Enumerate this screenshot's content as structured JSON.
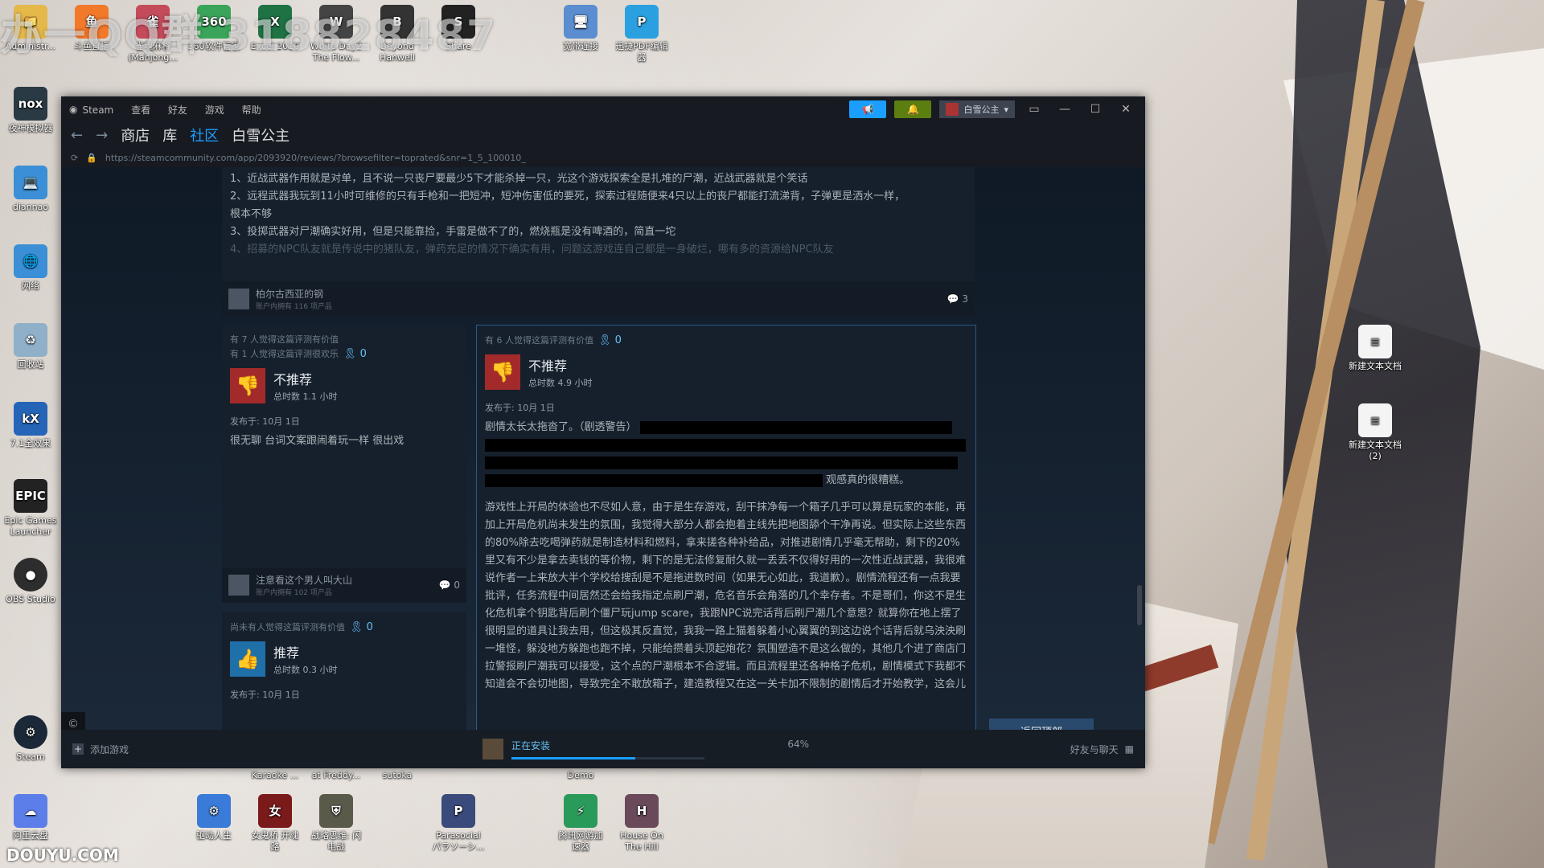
{
  "watermark": "办一QQ群 318828487",
  "brand": "DOUYU.COM",
  "desktop_icons": {
    "admin": "Administr...",
    "douyu_live": "斗鱼直播",
    "mahjong": "雀魂麻将\n(Mahjong...",
    "guanjia": "360软件管家",
    "excel": "Excel 2010",
    "whiteday": "White Day2\nThe Flow...",
    "beyond": "Beyond\nHanwell",
    "share": "Share",
    "broadband": "宽带连接",
    "pdf": "迅捷PDF编辑\n器",
    "nox": "夜神模拟器",
    "diannao": "diannao",
    "network": "网络",
    "recycle": "回收站",
    "kx": "7.1全效果",
    "epic": "Epic Games\nLauncher",
    "obs": "OBS Studio",
    "steam": "Steam",
    "newtxt1": "新建文本文档",
    "newtxt2": "新建文本文档\n(2)",
    "karaoke": "Karaoke ...",
    "freddy": "at Freddy...",
    "sutoka": "sutoka",
    "demo": "Demo",
    "driver": "驱动人生",
    "girl": "女鬼桥 开魂\n路",
    "strategy": "战略思维: 闪\n电战",
    "parasocial": "Parasocial\nパラソーシ...",
    "booster": "腾讯网游加\n速器",
    "house": "House On\nThe Hill",
    "alidrive": "阿里云盘"
  },
  "steam": {
    "menu": [
      "Steam",
      "查看",
      "好友",
      "游戏",
      "帮助"
    ],
    "user": "白雪公主",
    "nav_tabs": [
      "商店",
      "库",
      "社区",
      "白雪公主"
    ],
    "url": "https://steamcommunity.com/app/2093920/reviews/?browsefilter=toprated&snr=1_5_100010_",
    "top_review": {
      "lines": [
        "1、近战武器作用就是对单，且不说一只丧尸要最少5下才能杀掉一只，光这个游戏探索全是扎堆的尸潮，近战武器就是个笑话",
        "2、远程武器我玩到11小时可维修的只有手枪和一把短冲，短冲伤害低的要死，探索过程随便来4只以上的丧尸都能打流涕背，子弹更是洒水一样，",
        "根本不够",
        "3、投掷武器对尸潮确实好用，但是只能靠捡，手雷是做不了的，燃烧瓶是没有啤酒的，简直一坨",
        "4、招募的NPC队友就是传说中的猪队友，弹药充足的情况下确实有用，问题这游戏连自己都是一身破烂，哪有多的资源给NPC队友"
      ],
      "author": "柏尔古西亚的钢",
      "author_sub": "账户内拥有 116 项产品",
      "comments": "3"
    },
    "card_left1": {
      "helpful1": "有 7 人觉得这篇评测有价值",
      "helpful2": "有 1 人觉得这篇评测很欢乐",
      "awards": "0",
      "verdict": "不推荐",
      "hours": "总时数 1.1 小时",
      "posted": "发布于: 10月 1日",
      "body": "很无聊 台词文案跟闹着玩一样 很出戏",
      "author": "注意看这个男人叫大山",
      "author_sub": "账户内拥有 102 项产品",
      "comments": "0"
    },
    "card_left2": {
      "helpful1": "尚未有人觉得这篇评测有价值",
      "awards": "0",
      "verdict": "推荐",
      "hours": "总时数 0.3 小时",
      "posted": "发布于: 10月 1日"
    },
    "card_right": {
      "helpful1": "有 6 人觉得这篇评测有价值",
      "awards": "0",
      "verdict": "不推荐",
      "hours": "总时数 4.9 小时",
      "posted": "发布于: 10月 1日",
      "line1": "剧情太长太拖沓了。（剧透警告）",
      "line_end": "观感真的很糟糕。",
      "body": "游戏性上开局的体验也不尽如人意，由于是生存游戏，刮干抹净每一个箱子几乎可以算是玩家的本能，再加上开局危机尚未发生的氛围，我觉得大部分人都会抱着主线先把地图舔个干净再说。但实际上这些东西的80%除去吃喝弹药就是制造材料和燃料，拿来搓各种补给品，对推进剧情几乎毫无帮助，剩下的20%里又有不少是拿去卖钱的等价物，剩下的是无法修复耐久就一丢丢不仅得好用的一次性近战武器，我很难说作者一上来放大半个学校给搜刮是不是拖进数时间（如果无心如此，我道歉）。剧情流程还有一点我要批评，任务流程中间居然还会给我指定点刷尸潮，危名音乐会角落的几个幸存者。不是哥们，你这不是生化危机拿个钥匙背后刷个僵尸玩jump scare，我跟NPC说完话背后刷尸潮几个意思？就算你在地上摆了很明显的道具让我去用，但这极其反直觉，我我一路上猫着躲着小心翼翼的到这边说个话背后就乌泱泱刷一堆怪，躲没地方躲跑也跑不掉，只能给攒着头顶起炮花？氛围塑造不是这么做的，其他几个进了商店门拉警报刷尸潮我可以接受，这个点的尸潮根本不合逻辑。而且流程里还各种格子危机，剧情模式下我都不知道会不会切地图，导致完全不敢放箱子，建造教程又在这一关卡加不限制的剧情后才开始教学，这会儿"
    },
    "back_to_top": "返回顶部",
    "bottom": {
      "add_game": "添加游戏",
      "installing": "正在安装",
      "progress": 64,
      "progress_label": "64%",
      "friends": "好友与聊天"
    }
  }
}
